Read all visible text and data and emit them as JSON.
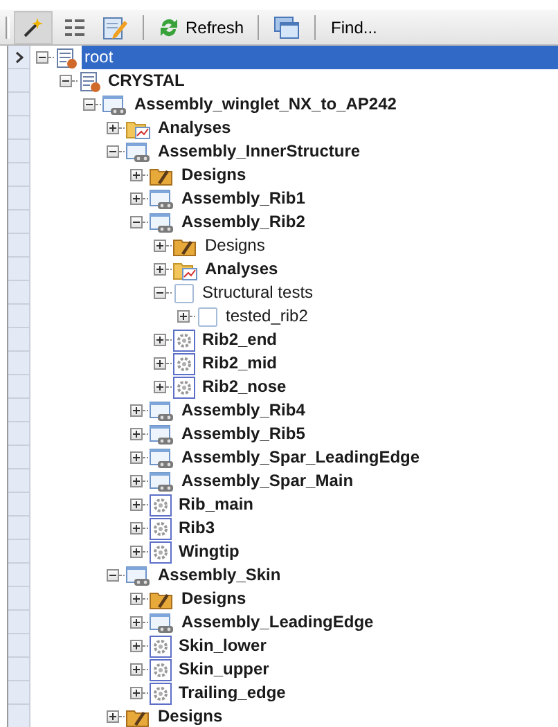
{
  "toolbar": [
    {
      "kind": "wand"
    },
    {
      "kind": "list"
    },
    {
      "kind": "edit"
    },
    {
      "kind": "separator"
    },
    {
      "kind": "refresh",
      "label": "Refresh"
    },
    {
      "kind": "separator"
    },
    {
      "kind": "window"
    },
    {
      "kind": "separator"
    },
    {
      "kind": "text",
      "label": "Find..."
    }
  ],
  "tree": [
    {
      "label": "root",
      "kind": "report",
      "bold": false,
      "selected": true,
      "expanded": true,
      "children": [
        {
          "label": "CRYSTAL",
          "kind": "report",
          "bold": true,
          "selected": false,
          "expanded": true,
          "children": [
            {
              "label": "Assembly_winglet_NX_to_AP242",
              "kind": "assembly",
              "bold": true,
              "selected": false,
              "expanded": true,
              "children": [
                {
                  "label": "Analyses",
                  "kind": "analyses",
                  "bold": true,
                  "selected": false,
                  "expanded": false
                },
                {
                  "label": "Assembly_InnerStructure",
                  "kind": "assembly",
                  "bold": true,
                  "selected": false,
                  "expanded": true,
                  "children": [
                    {
                      "label": "Designs",
                      "kind": "designs",
                      "bold": true,
                      "selected": false,
                      "expanded": false
                    },
                    {
                      "label": "Assembly_Rib1",
                      "kind": "assembly",
                      "bold": true,
                      "selected": false,
                      "expanded": false
                    },
                    {
                      "label": "Assembly_Rib2",
                      "kind": "assembly",
                      "bold": true,
                      "selected": false,
                      "expanded": true,
                      "children": [
                        {
                          "label": "Designs",
                          "kind": "designs",
                          "bold": false,
                          "selected": false,
                          "expanded": false
                        },
                        {
                          "label": "Analyses",
                          "kind": "analyses",
                          "bold": true,
                          "selected": false,
                          "expanded": false
                        },
                        {
                          "label": "Structural tests",
                          "kind": "blank",
                          "bold": false,
                          "selected": false,
                          "expanded": true,
                          "children": [
                            {
                              "label": "tested_rib2",
                              "kind": "blank",
                              "bold": false,
                              "selected": false,
                              "expanded": false
                            }
                          ]
                        },
                        {
                          "label": "Rib2_end",
                          "kind": "part",
                          "bold": true,
                          "selected": false,
                          "expanded": false
                        },
                        {
                          "label": "Rib2_mid",
                          "kind": "part",
                          "bold": true,
                          "selected": false,
                          "expanded": false
                        },
                        {
                          "label": "Rib2_nose",
                          "kind": "part",
                          "bold": true,
                          "selected": false,
                          "expanded": false
                        }
                      ]
                    },
                    {
                      "label": "Assembly_Rib4",
                      "kind": "assembly",
                      "bold": true,
                      "selected": false,
                      "expanded": false
                    },
                    {
                      "label": "Assembly_Rib5",
                      "kind": "assembly",
                      "bold": true,
                      "selected": false,
                      "expanded": false
                    },
                    {
                      "label": "Assembly_Spar_LeadingEdge",
                      "kind": "assembly",
                      "bold": true,
                      "selected": false,
                      "expanded": false
                    },
                    {
                      "label": "Assembly_Spar_Main",
                      "kind": "assembly",
                      "bold": true,
                      "selected": false,
                      "expanded": false
                    },
                    {
                      "label": "Rib_main",
                      "kind": "part",
                      "bold": true,
                      "selected": false,
                      "expanded": false
                    },
                    {
                      "label": "Rib3",
                      "kind": "part",
                      "bold": true,
                      "selected": false,
                      "expanded": false
                    },
                    {
                      "label": "Wingtip",
                      "kind": "part",
                      "bold": true,
                      "selected": false,
                      "expanded": false
                    }
                  ]
                },
                {
                  "label": "Assembly_Skin",
                  "kind": "assembly",
                  "bold": true,
                  "selected": false,
                  "expanded": true,
                  "children": [
                    {
                      "label": "Designs",
                      "kind": "designs",
                      "bold": true,
                      "selected": false,
                      "expanded": false
                    },
                    {
                      "label": "Assembly_LeadingEdge",
                      "kind": "assembly",
                      "bold": true,
                      "selected": false,
                      "expanded": false
                    },
                    {
                      "label": "Skin_lower",
                      "kind": "part",
                      "bold": true,
                      "selected": false,
                      "expanded": false
                    },
                    {
                      "label": "Skin_upper",
                      "kind": "part",
                      "bold": true,
                      "selected": false,
                      "expanded": false
                    },
                    {
                      "label": "Trailing_edge",
                      "kind": "part",
                      "bold": true,
                      "selected": false,
                      "expanded": false
                    }
                  ]
                },
                {
                  "label": "Designs",
                  "kind": "designs",
                  "bold": true,
                  "selected": false,
                  "expanded": false
                }
              ]
            }
          ]
        }
      ]
    }
  ]
}
